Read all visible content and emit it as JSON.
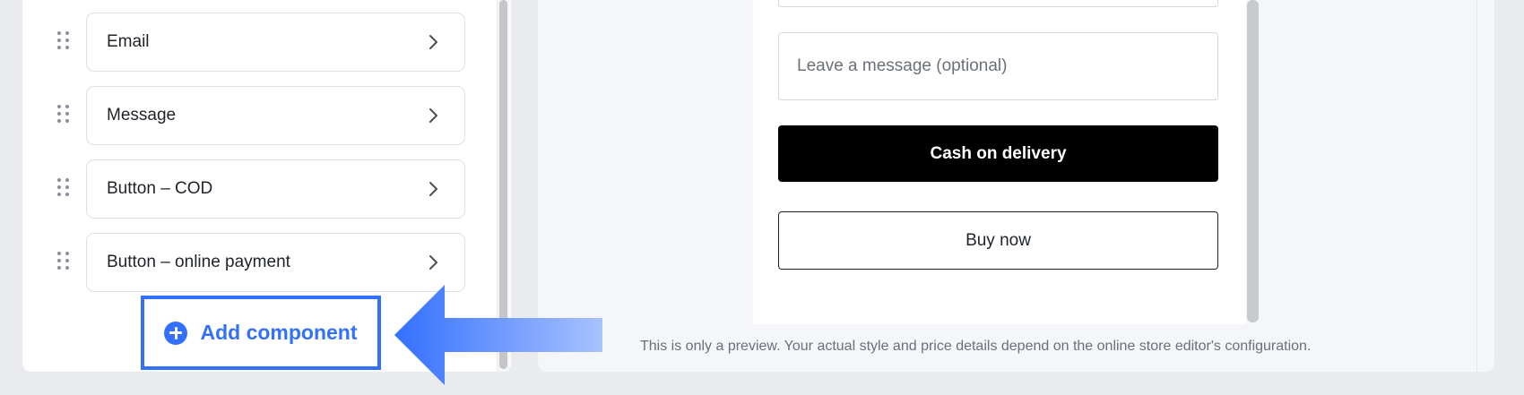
{
  "components": {
    "items": [
      {
        "label": "Email"
      },
      {
        "label": "Message"
      },
      {
        "label": "Button – COD"
      },
      {
        "label": "Button – online payment"
      }
    ],
    "add_label": "Add component"
  },
  "preview": {
    "message_placeholder": "Leave a message (optional)",
    "cod_label": "Cash on delivery",
    "buy_label": "Buy now",
    "note": "This is only a preview. Your actual style and price details depend on the online store editor's configuration."
  },
  "colors": {
    "accent": "#3370ff",
    "panel_bg": "#ffffff",
    "page_bg": "#e9ebef",
    "cod_bg": "#000000"
  },
  "icons": [
    "drag-handle-icon",
    "chevron-right-icon",
    "plus-circle-icon",
    "arrow-left-icon"
  ]
}
